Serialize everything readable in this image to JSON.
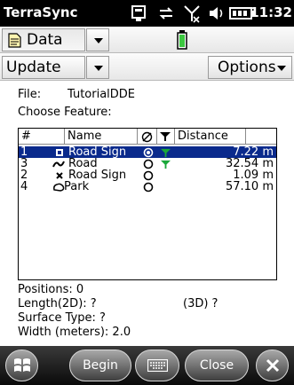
{
  "status_bar": {
    "app_title": "TerraSync",
    "clock": "11:32",
    "icons": [
      "connection-icon",
      "sync-icon",
      "signal-off-icon",
      "volume-icon",
      "battery-icon"
    ]
  },
  "toolbar1": {
    "section_label": "Data",
    "section_icon": "document-icon",
    "status_icon": "battery-status-icon"
  },
  "toolbar2": {
    "subsection_label": "Update",
    "options_label": "Options"
  },
  "form": {
    "file_label": "File:",
    "file_value": "TutorialDDE",
    "choose_feature_label": "Choose Feature:"
  },
  "table": {
    "headers": {
      "num": "#",
      "name": "Name",
      "status_icon": "satellite-icon",
      "filter_icon": "filter-icon",
      "distance": "Distance"
    },
    "rows": [
      {
        "num": "1",
        "icon": "square-point-icon",
        "name": "Road Sign",
        "status": "selected-circle",
        "filter": "filter-icon",
        "distance": "7.22 m",
        "selected": true
      },
      {
        "num": "3",
        "icon": "line-icon",
        "name": "Road",
        "status": "empty-circle",
        "filter": "filter-icon",
        "distance": "32.54 m",
        "selected": false
      },
      {
        "num": "2",
        "icon": "x-point-icon",
        "name": "Road Sign",
        "status": "empty-circle",
        "filter": "",
        "distance": "1.09 m",
        "selected": false
      },
      {
        "num": "4",
        "icon": "area-icon",
        "name": "Park",
        "status": "empty-circle",
        "filter": "",
        "distance": "57.10 m",
        "selected": false
      }
    ]
  },
  "info": {
    "positions": "Positions:  0",
    "length2d": "Length(2D):     ?",
    "length3d": "(3D)  ?",
    "surface_type": "Surface Type: ?",
    "width": "Width (meters): 2.0"
  },
  "bottom_bar": {
    "begin_label": "Begin",
    "close_label": "Close"
  },
  "colors": {
    "selection": "#0a2a8c",
    "filter_green": "#1aa83a"
  }
}
